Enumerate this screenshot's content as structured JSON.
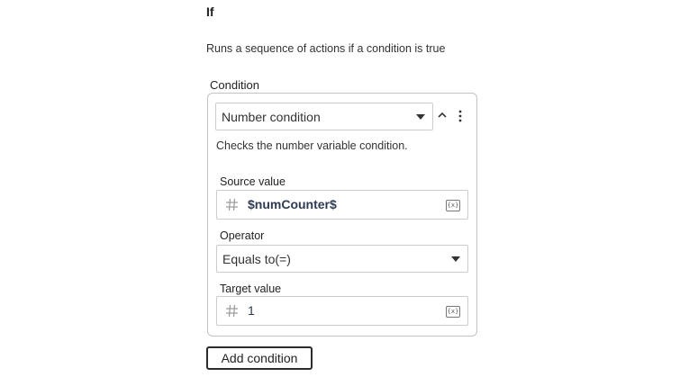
{
  "action": {
    "title": "If",
    "description": "Runs a sequence of actions if a condition is true"
  },
  "condition": {
    "label": "Condition",
    "type_value": "Number condition",
    "help_text": "Checks the number variable condition.",
    "source": {
      "label": "Source value",
      "value": "$numCounter$",
      "var_icon_text": "{x}"
    },
    "operator": {
      "label": "Operator",
      "value": "Equals to(=)"
    },
    "target": {
      "label": "Target value",
      "value": "1",
      "var_icon_text": "{x}"
    }
  },
  "add_condition_label": "Add condition",
  "icons": {
    "collapse": "chevron-up-icon",
    "more": "more-vertical-icon",
    "hash": "hash-icon",
    "variable": "variable-icon",
    "dropdown": "caret-down-icon"
  }
}
